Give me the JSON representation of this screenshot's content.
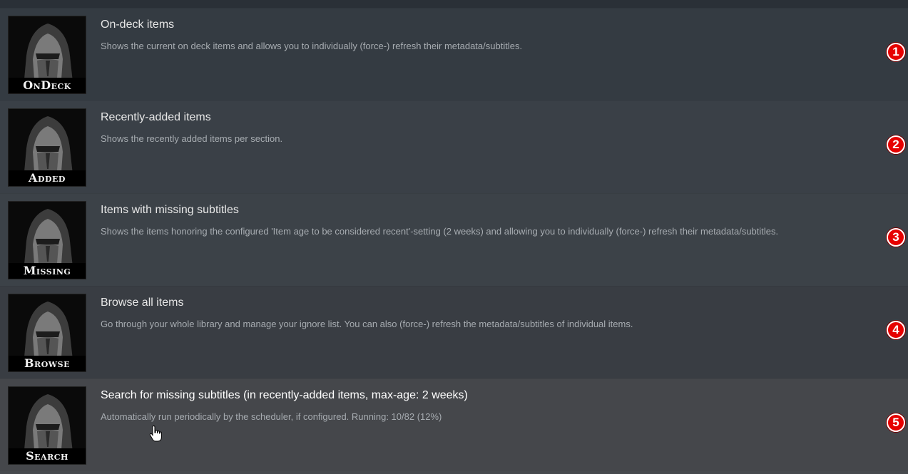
{
  "items": [
    {
      "title": "On-deck items",
      "description": "Shows the current on deck items and allows you to individually (force-) refresh their metadata/subtitles.",
      "thumb_label": "OnDeck",
      "badge": "1"
    },
    {
      "title": "Recently-added items",
      "description": "Shows the recently added items per section.",
      "thumb_label": "Added",
      "badge": "2"
    },
    {
      "title": "Items with missing subtitles",
      "description": "Shows the items honoring the configured 'Item age to be considered recent'-setting (2 weeks) and allowing you to individually (force-) refresh their metadata/subtitles.",
      "thumb_label": "Missing",
      "badge": "3"
    },
    {
      "title": "Browse all items",
      "description": "Go through your whole library and manage your ignore list. You can also (force-) refresh the metadata/subtitles of individual items.",
      "thumb_label": "Browse",
      "badge": "4"
    },
    {
      "title": "Search for missing subtitles (in recently-added items, max-age: 2 weeks)",
      "description": "Automatically run periodically by the scheduler, if configured. Running: 10/82 (12%)",
      "thumb_label": "Search",
      "badge": "5"
    }
  ],
  "colors": {
    "badge": "#e60000",
    "row_background": "#3a4047",
    "title_text": "#e6e6e6",
    "description_text": "#a7acb1"
  },
  "icons": {
    "cursor": "hand-pointer-icon",
    "thumbnail": "hooded-masked-warrior-artwork"
  }
}
